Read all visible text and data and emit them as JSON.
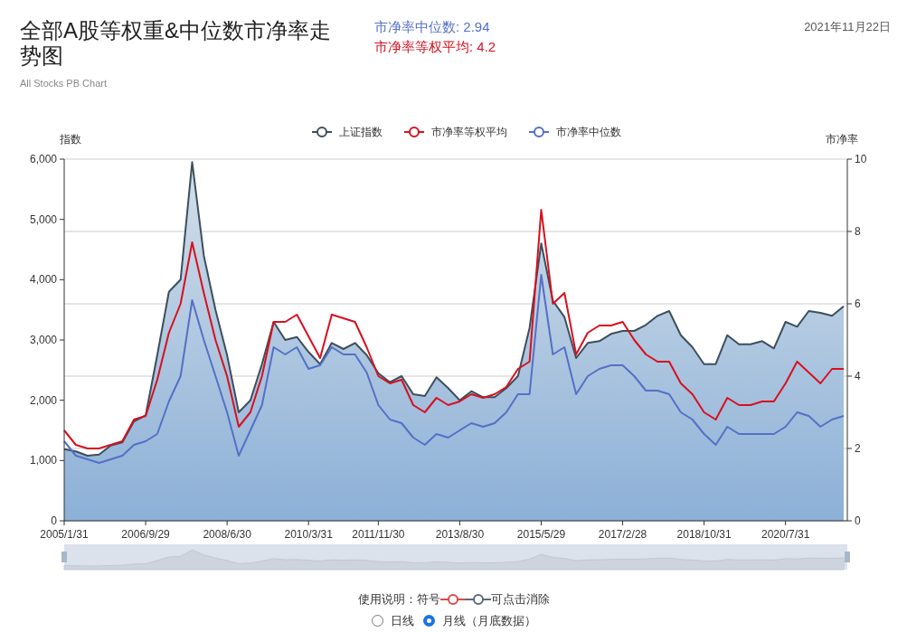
{
  "header": {
    "title": "全部A股等权重&中位数市净率走势图",
    "subtitle": "All Stocks PB Chart",
    "date": "2021年11月22日"
  },
  "stats": [
    {
      "text": "市净率中位数: 2.94",
      "color": "#5470c6"
    },
    {
      "text": "市净率等权平均: 4.2",
      "color": "#d7101e"
    }
  ],
  "chart": {
    "chart_data": {
      "type": "line",
      "grid": true,
      "legend": true,
      "ylabel": "指数",
      "y2label": "市净率",
      "categories": [
        "2005/1/31",
        null,
        null,
        null,
        null,
        null,
        null,
        "2006/9/29",
        null,
        null,
        null,
        null,
        null,
        null,
        "2008/6/30",
        null,
        null,
        null,
        null,
        null,
        null,
        "2010/3/31",
        null,
        null,
        null,
        null,
        null,
        "2011/11/30",
        null,
        null,
        null,
        null,
        null,
        null,
        "2013/8/30",
        null,
        null,
        null,
        null,
        null,
        null,
        "2015/5/29",
        null,
        null,
        null,
        null,
        null,
        null,
        "2017/2/28",
        null,
        null,
        null,
        null,
        null,
        null,
        "2018/10/31",
        null,
        null,
        null,
        null,
        null,
        null,
        "2020/7/31",
        null,
        null,
        null,
        null,
        null
      ],
      "series": [
        {
          "name": "上证指数",
          "color": "#3d4f5c",
          "type": "area",
          "values": [
            1190,
            1150,
            1080,
            1100,
            1250,
            1300,
            1650,
            1750,
            2750,
            3800,
            4000,
            5950,
            4400,
            3500,
            2750,
            1800,
            2000,
            2600,
            3300,
            3000,
            3050,
            2800,
            2600,
            2950,
            2850,
            2950,
            2750,
            2450,
            2300,
            2400,
            2100,
            2070,
            2380,
            2200,
            2000,
            2150,
            2050,
            2050,
            2200,
            2400,
            3200,
            4600,
            3650,
            3380,
            2700,
            2950,
            2980,
            3100,
            3150,
            3150,
            3250,
            3400,
            3480,
            3080,
            2880,
            2600,
            2600,
            3080,
            2930,
            2930,
            2980,
            2860,
            3300,
            3220,
            3480,
            3450,
            3400,
            3560
          ]
        },
        {
          "name": "市净率等权平均",
          "color": "#d7101e",
          "axis": "y2",
          "values": [
            2.5,
            2.1,
            2.0,
            2.0,
            2.1,
            2.2,
            2.8,
            2.9,
            3.9,
            5.2,
            6.0,
            7.7,
            6.3,
            5.0,
            4.0,
            2.6,
            3.0,
            4.0,
            5.5,
            5.5,
            5.7,
            5.1,
            4.5,
            5.7,
            5.6,
            5.5,
            4.8,
            4.0,
            3.8,
            3.9,
            3.2,
            3.0,
            3.4,
            3.2,
            3.3,
            3.5,
            3.4,
            3.5,
            3.7,
            4.2,
            4.4,
            8.6,
            6.0,
            6.3,
            4.6,
            5.2,
            5.4,
            5.4,
            5.5,
            5.0,
            4.6,
            4.4,
            4.4,
            3.8,
            3.5,
            3.0,
            2.8,
            3.4,
            3.2,
            3.2,
            3.3,
            3.3,
            3.8,
            4.4,
            4.1,
            3.8,
            4.2,
            4.2
          ]
        },
        {
          "name": "市净率中位数",
          "color": "#5470c6",
          "axis": "y2",
          "values": [
            2.2,
            1.8,
            1.7,
            1.6,
            1.7,
            1.8,
            2.1,
            2.2,
            2.4,
            3.3,
            4.0,
            6.1,
            5.0,
            4.0,
            3.0,
            1.8,
            2.5,
            3.2,
            4.8,
            4.6,
            4.8,
            4.2,
            4.3,
            4.8,
            4.6,
            4.6,
            4.1,
            3.2,
            2.8,
            2.7,
            2.3,
            2.1,
            2.4,
            2.3,
            2.5,
            2.7,
            2.6,
            2.7,
            3.0,
            3.5,
            3.5,
            6.8,
            4.6,
            4.8,
            3.5,
            4.0,
            4.2,
            4.3,
            4.3,
            4.0,
            3.6,
            3.6,
            3.5,
            3.0,
            2.8,
            2.4,
            2.1,
            2.6,
            2.4,
            2.4,
            2.4,
            2.4,
            2.6,
            3.0,
            2.9,
            2.6,
            2.8,
            2.9
          ]
        }
      ],
      "ylim": [
        0,
        6000
      ],
      "yticks": [
        {
          "value": 0,
          "label": "0"
        },
        {
          "value": 1000,
          "label": "1,000"
        },
        {
          "value": 2000,
          "label": "2,000"
        },
        {
          "value": 3000,
          "label": "3,000"
        },
        {
          "value": 4000,
          "label": "4,000"
        },
        {
          "value": 5000,
          "label": "5,000"
        },
        {
          "value": 6000,
          "label": "6,000"
        }
      ],
      "y2lim": [
        0,
        10
      ],
      "y2ticks": [
        0,
        2,
        4,
        6,
        8,
        10
      ]
    }
  },
  "instructions": {
    "prefix": "使用说明：符号",
    "suffix": "可点击消除"
  },
  "modes": [
    {
      "label": "日线",
      "selected": false
    },
    {
      "label": "月线（月底数据）",
      "selected": true
    }
  ]
}
